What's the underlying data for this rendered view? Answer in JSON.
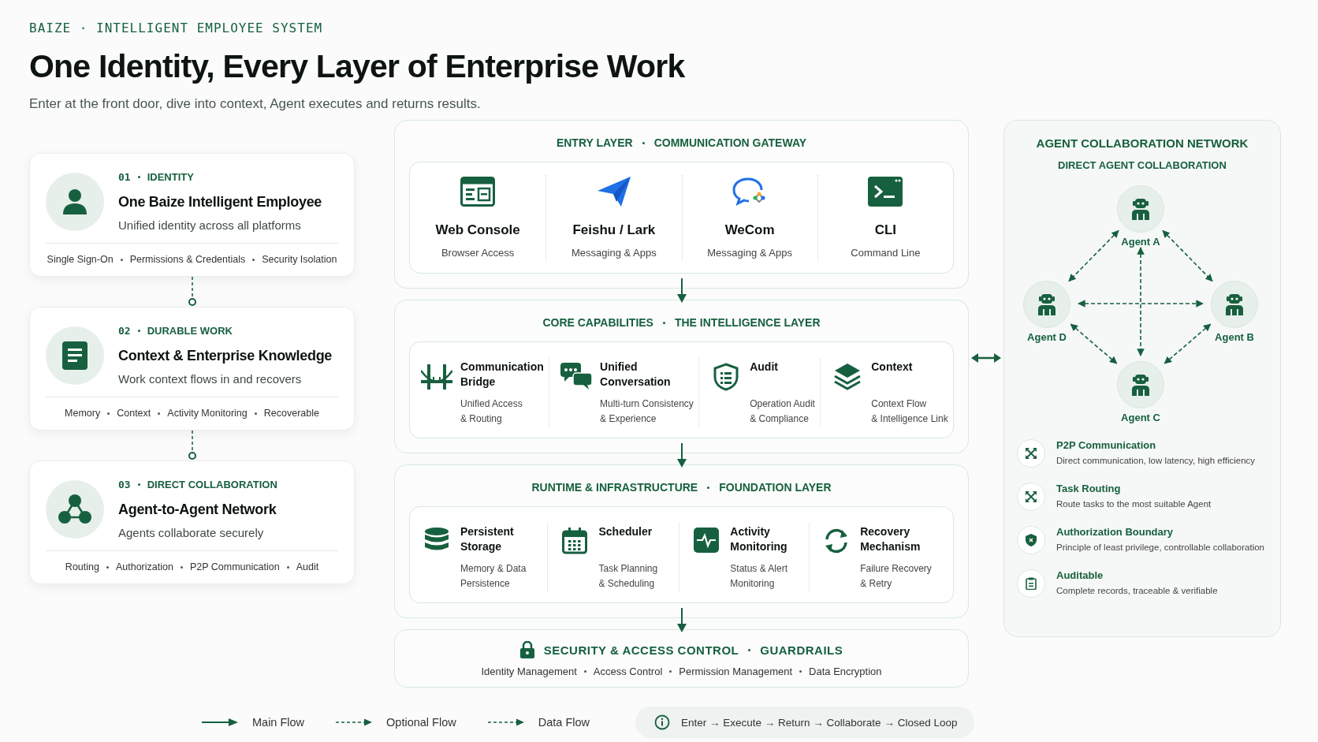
{
  "header": {
    "eyebrow": "BAIZE · INTELLIGENT EMPLOYEE SYSTEM",
    "title": "One Identity, Every Layer of Enterprise Work",
    "subtitle": "Enter at the front door, dive into context, Agent executes and returns results."
  },
  "pillars": [
    {
      "number": "01",
      "category": "IDENTITY",
      "title": "One Baize Intelligent Employee",
      "description": "Unified identity across all platforms",
      "tags": [
        "Single Sign-On",
        "Permissions & Credentials",
        "Security Isolation"
      ]
    },
    {
      "number": "02",
      "category": "DURABLE WORK",
      "title": "Context & Enterprise Knowledge",
      "description": "Work context flows in and recovers",
      "tags": [
        "Memory",
        "Context",
        "Activity Monitoring",
        "Recoverable"
      ]
    },
    {
      "number": "03",
      "category": "DIRECT COLLABORATION",
      "title": "Agent-to-Agent Network",
      "description": "Agents collaborate securely",
      "tags": [
        "Routing",
        "Authorization",
        "P2P Communication",
        "Audit"
      ]
    }
  ],
  "layers": [
    {
      "kind": "channels",
      "heading": "ENTRY LAYER",
      "subheading": "COMMUNICATION GATEWAY",
      "items": [
        {
          "name": [
            "Web Console"
          ],
          "description": [
            "Browser Access"
          ]
        },
        {
          "name": [
            "Feishu / Lark"
          ],
          "description": [
            "Messaging & Apps"
          ]
        },
        {
          "name": [
            "WeCom"
          ],
          "description": [
            "Messaging & Apps"
          ]
        },
        {
          "name": [
            "CLI"
          ],
          "description": [
            "Command Line"
          ]
        }
      ]
    },
    {
      "kind": "modules",
      "heading": "CORE CAPABILITIES",
      "subheading": "THE INTELLIGENCE LAYER",
      "items": [
        {
          "name": [
            "Communication",
            "Bridge"
          ],
          "description": [
            "Unified Access",
            "& Routing"
          ]
        },
        {
          "name": [
            "Unified",
            "Conversation"
          ],
          "description": [
            "Multi-turn Consistency",
            "& Experience"
          ]
        },
        {
          "name": [
            "Audit"
          ],
          "description": [
            "Operation Audit",
            "& Compliance"
          ]
        },
        {
          "name": [
            "Context"
          ],
          "description": [
            "Context Flow",
            "& Intelligence Link"
          ]
        }
      ]
    },
    {
      "kind": "modules",
      "heading": "RUNTIME & INFRASTRUCTURE",
      "subheading": "FOUNDATION LAYER",
      "items": [
        {
          "name": [
            "Persistent",
            "Storage"
          ],
          "description": [
            "Memory & Data",
            "Persistence"
          ]
        },
        {
          "name": [
            "Scheduler"
          ],
          "description": [
            "Task Planning",
            "& Scheduling"
          ]
        },
        {
          "name": [
            "Activity",
            "Monitoring"
          ],
          "description": [
            "Status & Alert",
            "Monitoring"
          ]
        },
        {
          "name": [
            "Recovery",
            "Mechanism"
          ],
          "description": [
            "Failure Recovery",
            "& Retry"
          ]
        }
      ]
    },
    {
      "kind": "guardrails",
      "heading": "SECURITY & ACCESS CONTROL",
      "subheading": "GUARDRAILS",
      "tags": [
        "Identity Management",
        "Access Control",
        "Permission Management",
        "Data Encryption"
      ]
    }
  ],
  "network": {
    "title": "AGENT COLLABORATION NETWORK",
    "subtitle": "DIRECT AGENT COLLABORATION",
    "agents": [
      {
        "name": "Agent A"
      },
      {
        "name": "Agent B"
      },
      {
        "name": "Agent C"
      },
      {
        "name": "Agent D"
      }
    ],
    "features": [
      {
        "title": "P2P Communication",
        "description": "Direct communication, low latency, high efficiency"
      },
      {
        "title": "Task Routing",
        "description": "Route tasks to the most suitable Agent"
      },
      {
        "title": "Authorization Boundary",
        "description": "Principle of least privilege, controllable collaboration"
      },
      {
        "title": "Auditable",
        "description": "Complete records, traceable & verifiable"
      }
    ]
  },
  "legend": [
    {
      "kind": "solid",
      "label": "Main Flow"
    },
    {
      "kind": "dashed",
      "label": "Optional Flow"
    },
    {
      "kind": "dashed",
      "label": "Data Flow"
    }
  ],
  "loop_note": "Enter → Execute → Return → Collaborate → Closed Loop"
}
